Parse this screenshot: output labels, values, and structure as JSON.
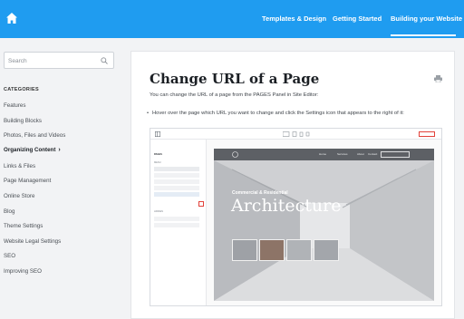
{
  "header": {
    "nav": [
      {
        "label": "Templates & Design"
      },
      {
        "label": "Getting Started"
      },
      {
        "label": "Building your Website"
      }
    ],
    "active_index": 2,
    "accent": "#1f9cf0"
  },
  "sidebar": {
    "search_placeholder": "Search",
    "categories_heading": "CATEGORIES",
    "items": [
      {
        "label": "Features"
      },
      {
        "label": "Building Blocks"
      },
      {
        "label": "Photos, Files and Videos"
      },
      {
        "label": "Organizing Content"
      },
      {
        "label": "Links & Files"
      },
      {
        "label": "Page Management"
      },
      {
        "label": "Online Store"
      },
      {
        "label": "Blog"
      },
      {
        "label": "Theme Settings"
      },
      {
        "label": "Website Legal Settings"
      },
      {
        "label": "SEO"
      },
      {
        "label": "Improving SEO"
      }
    ],
    "active_item": "Organizing Content"
  },
  "article": {
    "title": "Change URL of a Page",
    "intro": "You can change the URL of a page from the PAGES Panel in Site Editor:",
    "bullet": "Hover over the page which URL you want to change and click the Settings icon that appears to the right of it:"
  },
  "screenshot": {
    "panel_title": "PAGES",
    "menu_label": "MENU",
    "hidden_label": "HIDDEN",
    "site_nav": [
      "Home",
      "Services",
      "About",
      "Contact"
    ],
    "hero_subtitle": "Commercial & Residential",
    "hero_title": "Architecture"
  },
  "icons": {
    "home": "home-icon",
    "search": "search-icon",
    "chevron": "chevron-right-icon",
    "print": "print-icon",
    "settings": "gear-icon"
  }
}
